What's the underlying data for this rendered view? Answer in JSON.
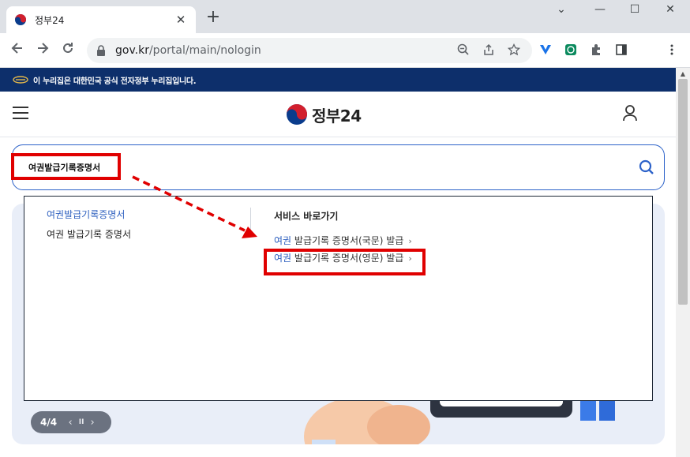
{
  "browser": {
    "tab_title": "정부24",
    "tab_close": "✕",
    "new_tab": "+",
    "url_host": "gov.kr",
    "url_path": "/portal/main/nologin",
    "window_minimize": "—",
    "window_maximize": "☐",
    "window_close": "✕",
    "window_dropdown": "⌄"
  },
  "site": {
    "gov_banner": "이 누리집은 대한민국 공식 전자정부 누리집입니다.",
    "logo_text": "정부24"
  },
  "search": {
    "query": "여권발급기록증명서"
  },
  "dropdown": {
    "suggestions": [
      "여권발급기록증명서",
      "여권 발급기록 증명서"
    ],
    "shortcut_heading": "서비스 바로가기",
    "services": [
      {
        "highlight": "여권",
        "rest": " 발급기록 증명서(국문) 발급"
      },
      {
        "highlight": "여권",
        "rest": " 발급기록 증명서(영문) 발급"
      }
    ],
    "arrow": "›"
  },
  "slider": {
    "count": "4/4",
    "prev": "‹",
    "pause": "II",
    "next": "›"
  },
  "colors": {
    "banner": "#0d2f6b",
    "accent": "#2c62c9",
    "annotation": "#e00000"
  }
}
